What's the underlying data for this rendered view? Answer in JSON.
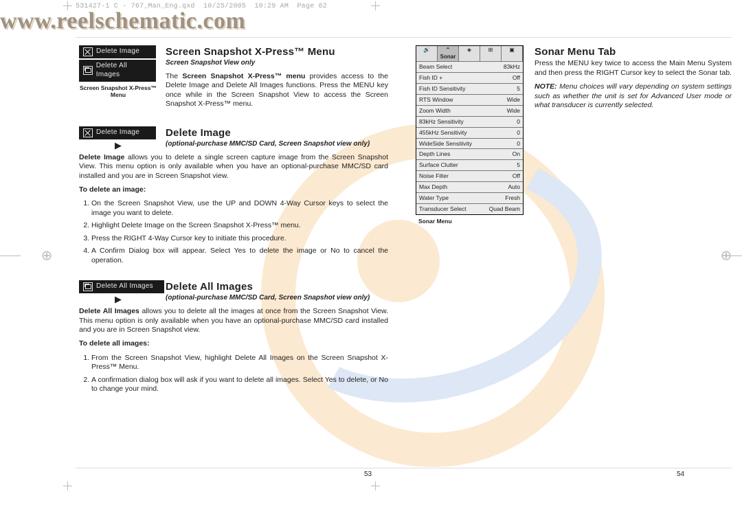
{
  "header": {
    "file": "531427-1 C - 767_Man_Eng.qxd",
    "date": "10/25/2005",
    "time": "10:29 AM",
    "page": "Page 62"
  },
  "watermark": "www.reelschematic.com",
  "left": {
    "menu": {
      "item1": "Delete Image",
      "item2": "Delete All Images",
      "caption": "Screen Snapshot X-Press™ Menu"
    },
    "sec1": {
      "title": "Screen Snapshot X-Press™ Menu",
      "sub": "Screen Snapshot View only",
      "body_a": "The ",
      "body_b": "Screen Snapshot X-Press™ menu",
      "body_c": " provides access to the Delete Image and Delete All Images functions. Press the MENU key once while in the Screen Snapshot View to access the Screen Snapshot X-Press™ menu."
    },
    "sec2": {
      "btn": "Delete Image",
      "title": "Delete Image",
      "sub": "(optional-purchase MMC/SD Card, Screen Snapshot view only)",
      "p1a": "Delete Image",
      "p1b": " allows you to delete a single screen capture image from the Screen Snapshot View. This menu option is only available when you have an optional-purchase MMC/SD card installed and you are in Screen Snapshot view.",
      "lead": "To delete an image:",
      "l1": "On the Screen Snapshot View, use the UP and DOWN 4-Way Cursor keys to select the image you want to delete.",
      "l2": "Highlight Delete Image on the Screen Snapshot X-Press™ menu.",
      "l3": "Press the RIGHT 4-Way Cursor key to initiate this procedure.",
      "l4": "A Confirm Dialog box will appear. Select Yes to delete the image or No to cancel the operation."
    },
    "sec3": {
      "btn": "Delete All Images",
      "title": "Delete All Images",
      "sub": "(optional-purchase MMC/SD Card, Screen Snapshot view only)",
      "p1a": "Delete All Images",
      "p1b": " allows you to delete all the images at once from the Screen Snapshot View. This menu option is only available when you have an optional-purchase MMC/SD card installed and you are in Screen Snapshot view.",
      "lead": "To delete all images:",
      "l1": "From the Screen Snapshot View, highlight Delete All Images on the Screen Snapshot X-Press™ Menu.",
      "l2": "A confirmation dialog box will ask if you want to delete all images. Select Yes to delete, or No to change your mind."
    },
    "pagenum": "53"
  },
  "right": {
    "title": "Sonar Menu Tab",
    "p1": "Press the MENU key twice to access the Main Menu System and then press the RIGHT Cursor key to select the Sonar tab.",
    "note_l": "NOTE:",
    "note_b": " Menu choices will vary depending on system settings such as whether the unit is set for Advanced User mode or what transducer is currently selected.",
    "tabsel": "⌃ Sonar",
    "rows": [
      {
        "k": "Beam Select",
        "v": "83kHz"
      },
      {
        "k": "Fish ID +",
        "v": "Off"
      },
      {
        "k": "Fish ID Sensitivity",
        "v": "5"
      },
      {
        "k": "RTS Window",
        "v": "Wide"
      },
      {
        "k": "Zoom Width",
        "v": "Wide"
      },
      {
        "k": "83kHz Sensitivity",
        "v": "0"
      },
      {
        "k": "455kHz Sensitivity",
        "v": "0"
      },
      {
        "k": "WideSide Sensitivity",
        "v": "0"
      },
      {
        "k": "Depth Lines",
        "v": "On"
      },
      {
        "k": "Surface Clutter",
        "v": "5"
      },
      {
        "k": "Noise Filter",
        "v": "Off"
      },
      {
        "k": "Max Depth",
        "v": "Auto"
      },
      {
        "k": "Water Type",
        "v": "Fresh"
      },
      {
        "k": "Transducer Select",
        "v": "Quad Beam"
      }
    ],
    "caption": "Sonar Menu",
    "pagenum": "54"
  }
}
